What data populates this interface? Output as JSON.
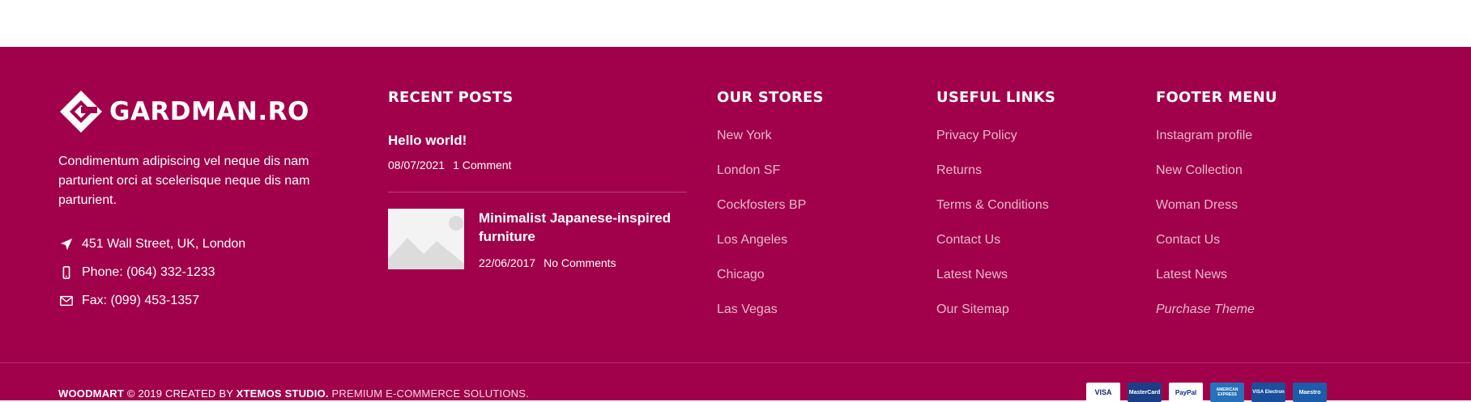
{
  "brand": {
    "logo_text": "GARDMAN.RO",
    "description": "Condimentum adipiscing vel neque dis nam parturient orci at scelerisque neque dis nam parturient."
  },
  "contacts": [
    {
      "icon": "location-arrow-icon",
      "text": "451 Wall Street, UK, London"
    },
    {
      "icon": "phone-icon",
      "text": "Phone: (064) 332-1233"
    },
    {
      "icon": "envelope-icon",
      "text": "Fax: (099) 453-1357"
    }
  ],
  "recent_posts": {
    "heading": "RECENT POSTS",
    "posts": [
      {
        "title": "Hello world!",
        "date": "08/07/2021",
        "comments": "1 Comment"
      },
      {
        "title": "Minimalist Japanese-inspired furniture",
        "date": "22/06/2017",
        "comments": "No Comments"
      }
    ]
  },
  "our_stores": {
    "heading": "OUR STORES",
    "items": [
      "New York",
      "London SF",
      "Cockfosters BP",
      "Los Angeles",
      "Chicago",
      "Las Vegas"
    ]
  },
  "useful_links": {
    "heading": "USEFUL LINKS",
    "items": [
      "Privacy Policy",
      "Returns",
      "Terms & Conditions",
      "Contact Us",
      "Latest News",
      "Our Sitemap"
    ]
  },
  "footer_menu": {
    "heading": "FOOTER MENU",
    "items": [
      "Instagram profile",
      "New Collection",
      "Woman Dress",
      "Contact Us",
      "Latest News",
      "Purchase Theme"
    ]
  },
  "copyright": {
    "brand": "WOODMART",
    "symbol": "©",
    "year_text": " 2019 CREATED BY ",
    "studio": "XTEMOS STUDIO.",
    "tagline": " PREMIUM E-COMMERCE SOLUTIONS."
  },
  "payment_cards": [
    {
      "name": "VISA",
      "color": "#1a1f71",
      "bg": "#ffffff"
    },
    {
      "name": "MasterCard",
      "color": "#ffffff",
      "bg": "#1b3f86"
    },
    {
      "name": "PayPal",
      "color": "#003087",
      "bg": "#ffffff"
    },
    {
      "name": "AMERICAN EXPRESS",
      "color": "#ffffff",
      "bg": "#2671b9"
    },
    {
      "name": "VISA Electron",
      "color": "#ffffff",
      "bg": "#1a4f9c"
    },
    {
      "name": "Maestro",
      "color": "#ffffff",
      "bg": "#1d5ca8"
    }
  ],
  "colors": {
    "footer_bg": "#a1004a",
    "text": "#ffffff"
  }
}
